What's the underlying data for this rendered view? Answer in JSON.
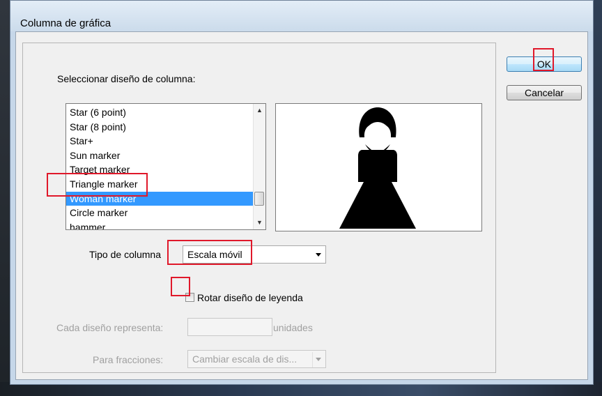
{
  "dialog": {
    "title": "Columna de gráfica"
  },
  "design_list": {
    "label": "Seleccionar diseño de columna:",
    "items": [
      {
        "label": "Star (6 point)",
        "selected": false
      },
      {
        "label": "Star (8 point)",
        "selected": false
      },
      {
        "label": "Star+",
        "selected": false
      },
      {
        "label": "Sun marker",
        "selected": false
      },
      {
        "label": "Target marker",
        "selected": false
      },
      {
        "label": "Triangle marker",
        "selected": false
      },
      {
        "label": "Woman marker",
        "selected": true
      },
      {
        "label": "Circle marker",
        "selected": false
      },
      {
        "label": "hammer",
        "selected": false
      }
    ],
    "scroll_up_icon": "scroll-up-arrow-icon",
    "scroll_down_icon": "scroll-down-arrow-icon"
  },
  "preview": {
    "icon": "woman-marker-icon"
  },
  "column_type": {
    "label": "Tipo de columna",
    "value": "Escala móvil"
  },
  "rotate_legend": {
    "label": "Rotar diseño de leyenda",
    "checked": false
  },
  "units": {
    "label": "Cada diseño representa:",
    "value": "",
    "suffix": "unidades"
  },
  "fractions": {
    "label": "Para fracciones:",
    "value": "Cambiar escala de dis..."
  },
  "buttons": {
    "ok": "OK",
    "cancel": "Cancelar"
  },
  "colors": {
    "selection": "#3399ff",
    "highlight": "#e0182a",
    "disabled_text": "#a0a0a0"
  }
}
